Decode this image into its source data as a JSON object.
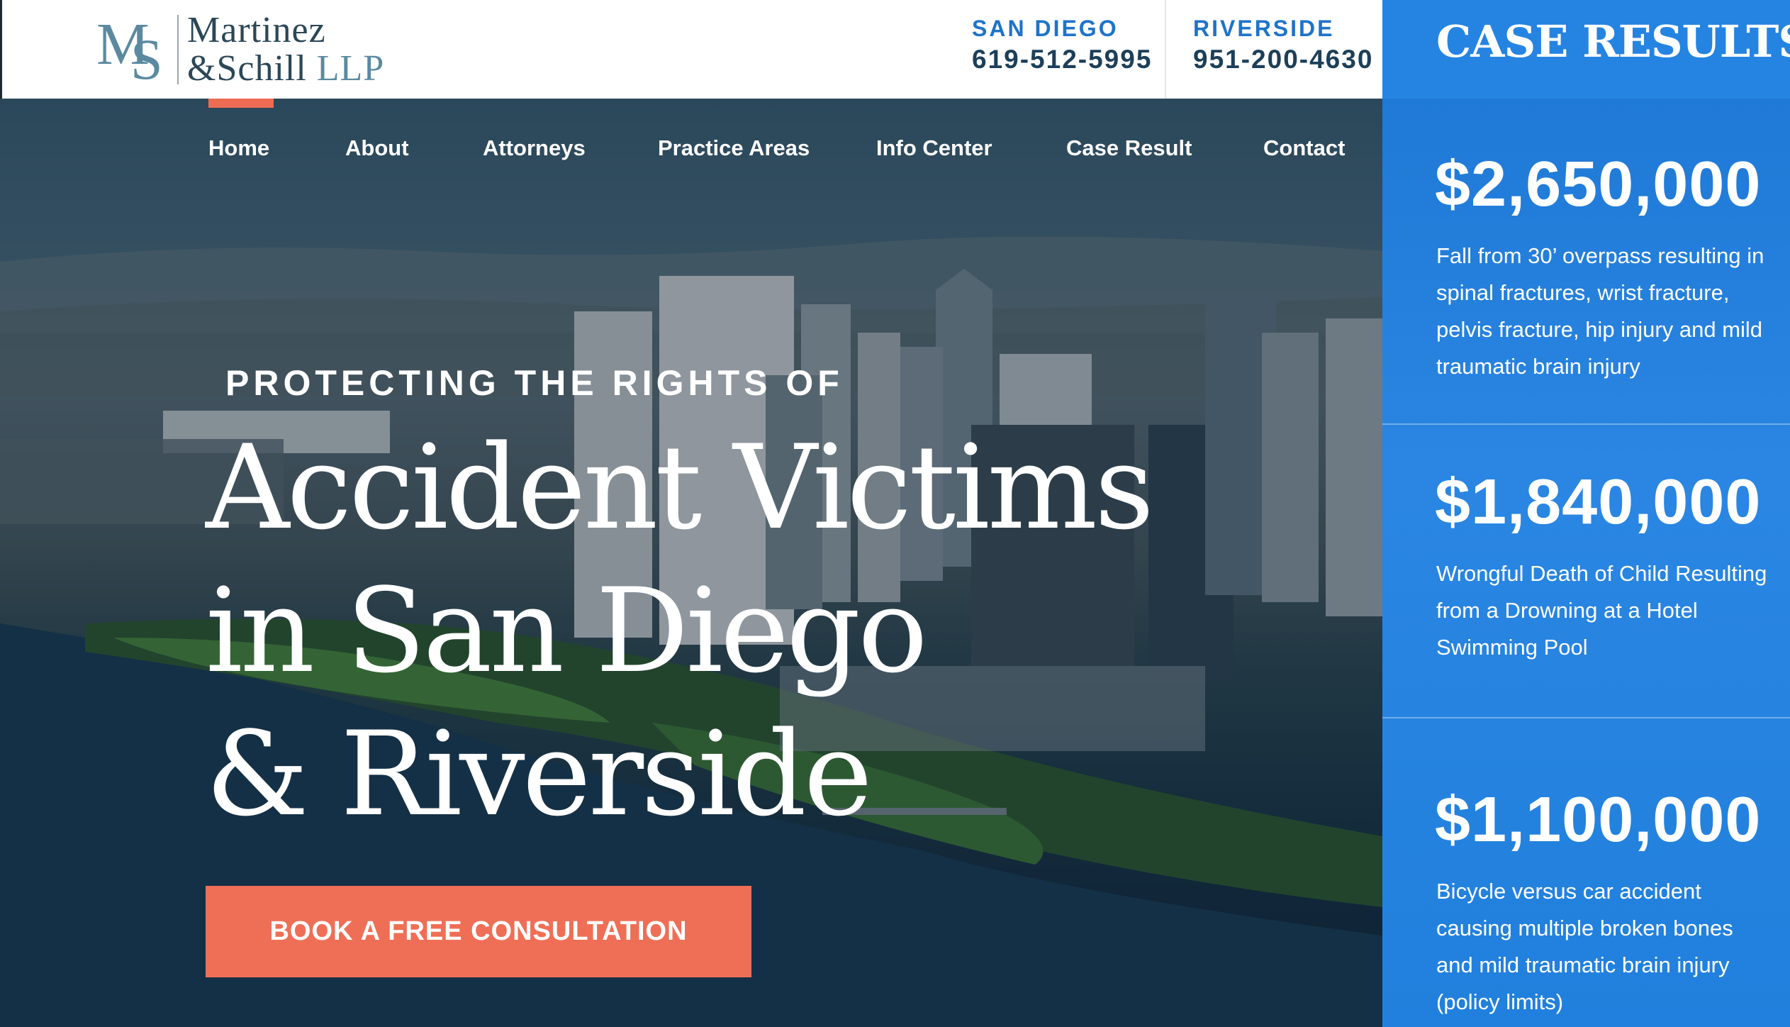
{
  "brand": {
    "mark_m": "M",
    "mark_s": "S",
    "line1": "Martinez",
    "line2_amp": "&Schill",
    "line2_llp": "LLP"
  },
  "contacts": [
    {
      "city": "SAN DIEGO",
      "phone": "619-512-5995"
    },
    {
      "city": "RIVERSIDE",
      "phone": "951-200-4630"
    }
  ],
  "nav": {
    "active": "Home",
    "items": [
      "Home",
      "About",
      "Attorneys",
      "Practice Areas",
      "Info Center",
      "Case Result",
      "Contact"
    ]
  },
  "hero": {
    "kicker": "PROTECTING THE RIGHTS OF",
    "headline_lines": [
      "Accident Victims",
      "in San Diego",
      "& Riverside"
    ],
    "cta_label": "BOOK A FREE CONSULTATION"
  },
  "case_results": {
    "title": "CASE RESULTS",
    "items": [
      {
        "amount": "$2,650,000",
        "description": "Fall from 30’ overpass resulting in spinal fractures, wrist fracture, pelvis fracture, hip injury and mild traumatic brain injury"
      },
      {
        "amount": "$1,840,000",
        "description": "Wrongful Death of Child Resulting from a Drowning at a Hotel Swimming Pool"
      },
      {
        "amount": "$1,100,000",
        "description": "Bicycle versus car accident causing multiple broken bones and mild traumatic brain injury (policy limits)"
      }
    ]
  },
  "colors": {
    "accent_orange": "#ef6f56",
    "panel_blue": "#2481df",
    "phone_city_blue": "#1f73c9",
    "logo_navy": "#2b4757"
  }
}
